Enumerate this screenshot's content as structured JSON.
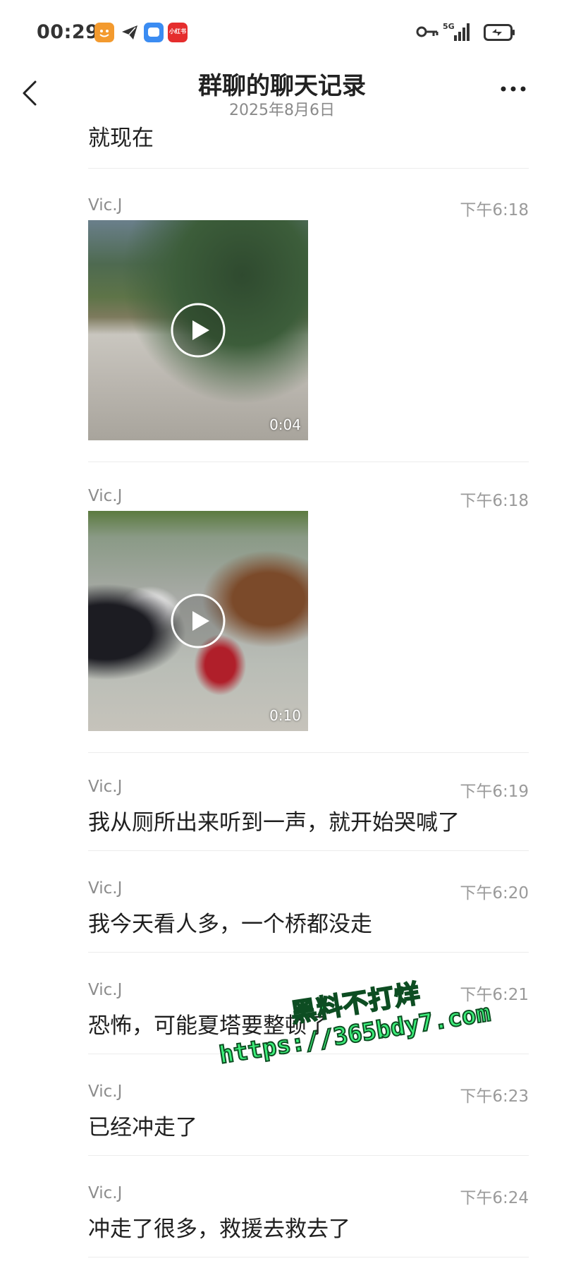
{
  "status_bar": {
    "time": "00:29",
    "app_icons": [
      "taobao-icon",
      "telegram-icon",
      "chat-bubble-icon",
      "xiaohongshu-icon"
    ],
    "xiaohongshu_label": "小红书",
    "network": "5G",
    "icons": [
      "vpn-key-icon",
      "signal-icon",
      "battery-charging-icon"
    ]
  },
  "header": {
    "title": "群聊的聊天记录",
    "date": "2025年8月6日"
  },
  "messages": [
    {
      "text": "就现在"
    },
    {
      "sender": "Vic.J",
      "time": "下午6:18",
      "type": "video",
      "duration": "0:04"
    },
    {
      "sender": "Vic.J",
      "time": "下午6:18",
      "type": "video",
      "duration": "0:10"
    },
    {
      "sender": "Vic.J",
      "time": "下午6:19",
      "text": "我从厕所出来听到一声，就开始哭喊了"
    },
    {
      "sender": "Vic.J",
      "time": "下午6:20",
      "text": "我今天看人多，一个桥都没走"
    },
    {
      "sender": "Vic.J",
      "time": "下午6:21",
      "text": "恐怖，可能夏塔要整顿了"
    },
    {
      "sender": "Vic.J",
      "time": "下午6:23",
      "text": "已经冲走了"
    },
    {
      "sender": "Vic.J",
      "time": "下午6:24",
      "text": "冲走了很多，救援去救去了"
    }
  ],
  "watermark": {
    "line1": "黑料不打烊",
    "line2": "https://365bdy7.com"
  },
  "colors": {
    "watermark_green": "#3cf07a",
    "text_gray": "#8c8c8c"
  }
}
